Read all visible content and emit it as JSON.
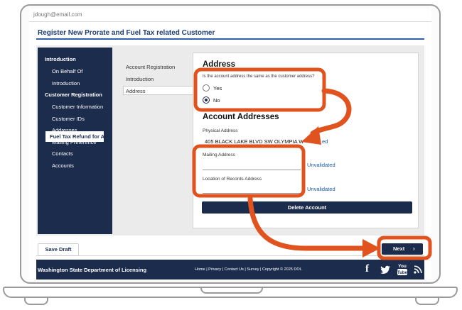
{
  "header": {
    "user_email": "jdough@email.com"
  },
  "page": {
    "title": "Register New Prorate and Fuel Tax related Customer"
  },
  "sidebar": {
    "items": [
      {
        "label": "Introduction"
      },
      {
        "label": "On Behalf Of"
      },
      {
        "label": "Introduction"
      },
      {
        "label": "Customer Registration"
      },
      {
        "label": "Customer Information"
      },
      {
        "label": "Customer IDs"
      },
      {
        "label": "Addresses"
      },
      {
        "label": "Mailing Preference"
      },
      {
        "label": "Contacts"
      },
      {
        "label": "Accounts"
      },
      {
        "label": "Fuel Tax Refund for A"
      }
    ]
  },
  "subnav": {
    "items": [
      {
        "label": "Account Registration"
      },
      {
        "label": "Introduction"
      },
      {
        "label": "Address"
      }
    ]
  },
  "panel": {
    "heading": "Address",
    "question": "Is the account address the same as the customer address?",
    "options": [
      {
        "label": "Yes",
        "checked": false
      },
      {
        "label": "No",
        "checked": true
      }
    ],
    "accounts_heading": "Account Addresses",
    "physical_label": "Physical Address",
    "physical_value": "405 BLACK LAKE BLVD SW OLYMPIA W",
    "physical_status_tail": "ed",
    "mailing_label": "Mailing Address",
    "mailing_value": "",
    "mailing_status": "Unvalidated",
    "records_label": "Location of Records Address",
    "records_value": "",
    "records_status": "Unvalidated",
    "delete_label": "Delete Account"
  },
  "actions": {
    "save_draft": "Save Draft",
    "next": "Next",
    "next_chevron": "›"
  },
  "footer": {
    "org": "Washington State Department of Licensing",
    "links": "Home | Privacy | Contact Us | Survey | Copyright © 2025 DOL",
    "social": [
      {
        "icon": "facebook-icon",
        "glyph": "f"
      },
      {
        "icon": "twitter-icon",
        "glyph": "🐦"
      },
      {
        "icon": "youtube-icon",
        "glyph": "You Tube"
      },
      {
        "icon": "rss-icon",
        "glyph": ""
      }
    ]
  },
  "annotation": {
    "color": "#e0531f"
  }
}
